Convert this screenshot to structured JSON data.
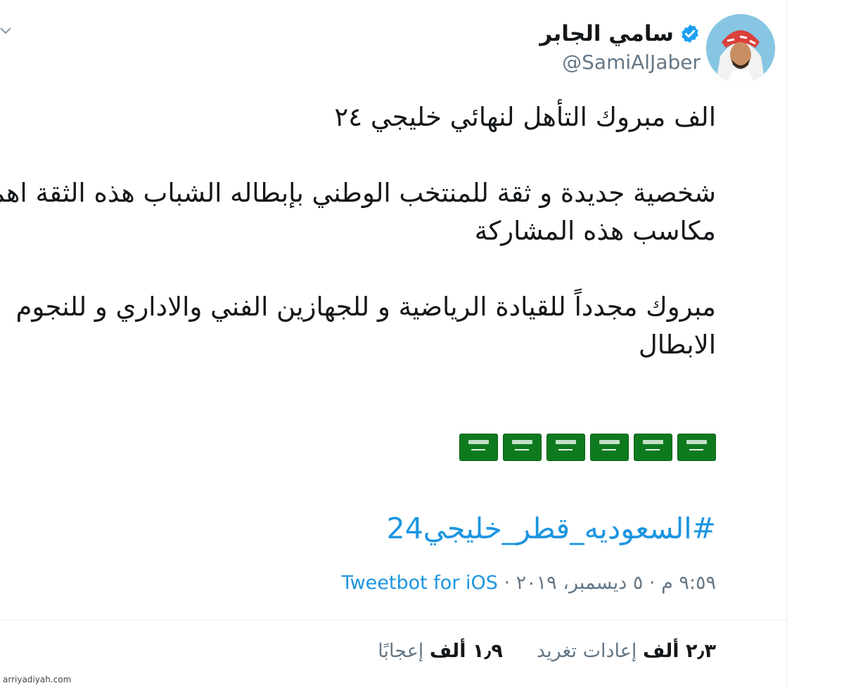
{
  "author": {
    "name": "سامي الجابر",
    "handle": "@SamiAlJaber",
    "verified": true
  },
  "tweet": {
    "paragraphs": [
      "الف مبروك التأهل لنهائي خليجي ٢٤",
      "شخصية جديدة و ثقة للمنتخب الوطني بإبطاله الشباب هذه الثقة اهم مكاسب هذه المشاركة",
      "مبروك مجدداً للقيادة الرياضية و للجهازين الفني والاداري و للنجوم الابطال"
    ],
    "flag_emoji_count": 6,
    "hashtag": "#السعوديه_قطر_خليجي24"
  },
  "meta": {
    "time_date": "٩:٥٩ م · ٥ ديسمبر، ٢٠١٩ · ",
    "source": "Tweetbot for iOS"
  },
  "stats": {
    "retweets_value": "٢٫٣ ألف",
    "retweets_label": "إعادات تغريد",
    "likes_value": "١٫٩ ألف",
    "likes_label": "إعجابًا"
  },
  "watermark": "arriyadiyah.com",
  "colors": {
    "link": "#1b95e0",
    "text": "#14171a",
    "muted": "#657786",
    "verified": "#1da1f2",
    "flag_green": "#0e7a1e"
  }
}
